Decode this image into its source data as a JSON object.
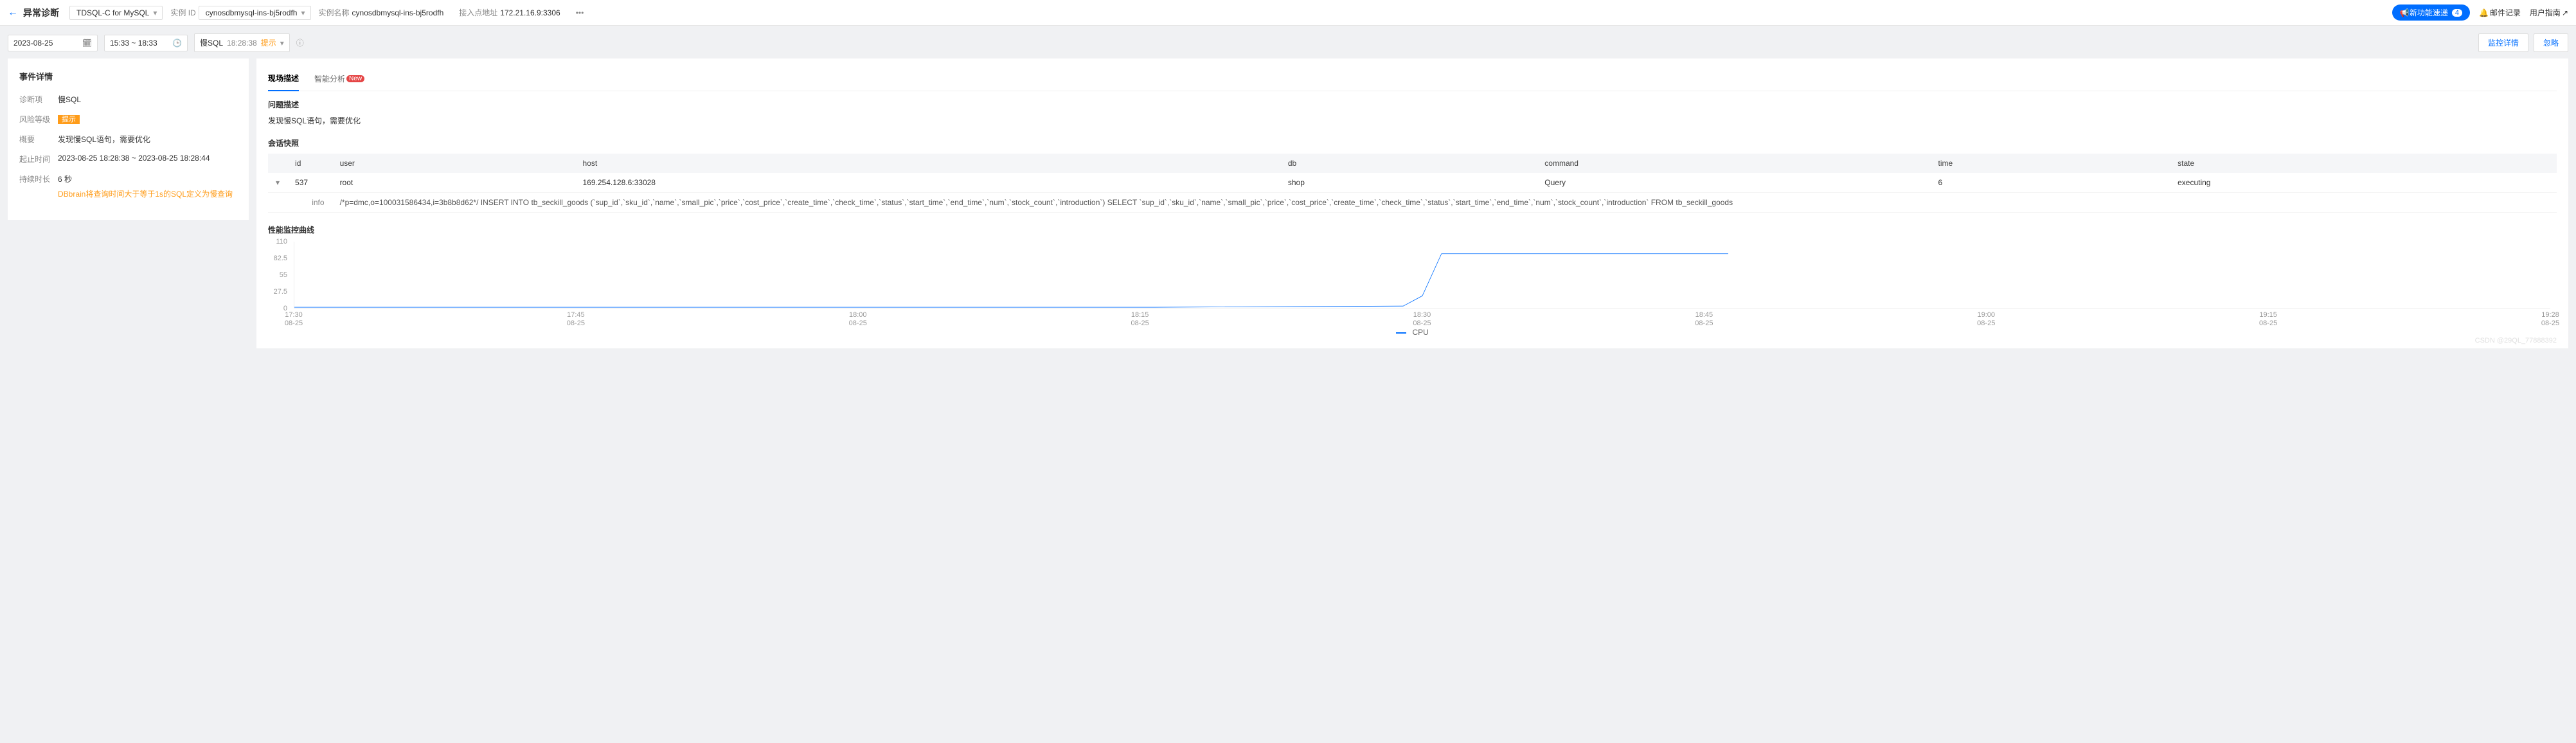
{
  "header": {
    "page_title": "异常诊断",
    "engine_selector": "TDSQL-C for MySQL",
    "instance_id_label": "实例 ID",
    "instance_id_value": "cynosdbmysql-ins-bj5rodfh",
    "instance_name_label": "实例名称",
    "instance_name_value": "cynosdbmysql-ins-bj5rodfh",
    "endpoint_label": "接入点地址",
    "endpoint_value": "172.21.16.9:3306",
    "new_feature_label": "新功能速递",
    "new_feature_count": "4",
    "mail_log": "邮件记录",
    "user_guide": "用户指南"
  },
  "filters": {
    "date": "2023-08-25",
    "time_range": "15:33 ~ 18:33",
    "slow_sql_label": "慢SQL",
    "slow_sql_time": "18:28:38",
    "slow_sql_hint": "提示",
    "btn_monitor_detail": "监控详情",
    "btn_ignore": "忽略"
  },
  "event_detail": {
    "panel_title": "事件详情",
    "rows": {
      "diag_label": "诊断项",
      "diag_value": "慢SQL",
      "risk_label": "风险等级",
      "risk_value": "提示",
      "summary_label": "概要",
      "summary_value": "发现慢SQL语句，需要优化",
      "time_label": "起止时间",
      "time_value": "2023-08-25 18:28:38 ~ 2023-08-25 18:28:44",
      "duration_label": "持续时长",
      "duration_value": "6 秒",
      "note": "DBbrain将查询时间大于等于1s的SQL定义为慢查询"
    }
  },
  "right": {
    "tab_scene": "现场描述",
    "tab_ai": "智能分析",
    "tab_ai_badge": "New",
    "problem_title": "问题描述",
    "problem_text": "发现慢SQL语句，需要优化",
    "session_title": "会话快照",
    "table": {
      "headers": [
        "id",
        "user",
        "host",
        "db",
        "command",
        "time",
        "state"
      ],
      "row": {
        "id": "537",
        "user": "root",
        "host": "169.254.128.6:33028",
        "db": "shop",
        "command": "Query",
        "time": "6",
        "state": "executing"
      },
      "info_label": "info",
      "info_value": "/*p=dmc,o=100031586434,i=3b8b8d62*/ INSERT INTO tb_seckill_goods (`sup_id`,`sku_id`,`name`,`small_pic`,`price`,`cost_price`,`create_time`,`check_time`,`status`,`start_time`,`end_time`,`num`,`stock_count`,`introduction`) SELECT `sup_id`,`sku_id`,`name`,`small_pic`,`price`,`cost_price`,`create_time`,`check_time`,`status`,`start_time`,`end_time`,`num`,`stock_count`,`introduction` FROM tb_seckill_goods"
    },
    "perf_title": "性能监控曲线",
    "legend": "CPU",
    "watermark": "CSDN @29QL_77888392"
  },
  "chart_data": {
    "type": "line",
    "title": "",
    "xlabel": "",
    "ylabel": "",
    "ylim": [
      0,
      110
    ],
    "series": [
      {
        "name": "CPU",
        "x": [
          "17:30",
          "17:45",
          "18:00",
          "18:15",
          "18:28",
          "18:29",
          "18:30",
          "18:45",
          "19:00",
          "19:15",
          "19:28"
        ],
        "x_date": "08-25",
        "values": [
          1,
          1,
          1,
          1,
          3,
          20,
          90,
          90,
          null,
          null,
          null
        ]
      }
    ],
    "y_ticks": [
      0,
      27.5,
      55,
      82.5,
      110
    ],
    "x_ticks": [
      "17:30",
      "17:45",
      "18:00",
      "18:15",
      "18:30",
      "18:45",
      "19:00",
      "19:15",
      "19:28"
    ]
  }
}
